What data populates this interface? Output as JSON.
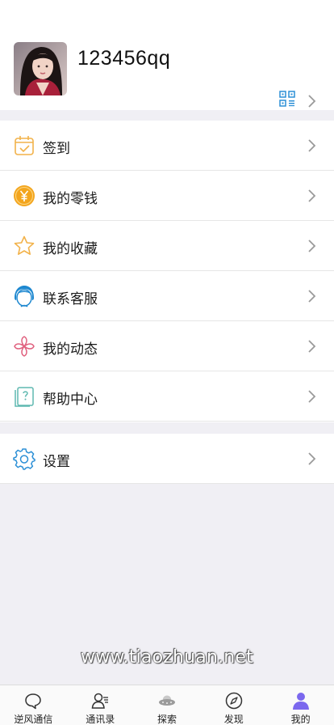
{
  "profile": {
    "username": "123456qq"
  },
  "menu": [
    {
      "label": "签到",
      "icon": "calendar-check-icon"
    },
    {
      "label": "我的零钱",
      "icon": "yuan-coin-icon"
    },
    {
      "label": "我的收藏",
      "icon": "star-icon"
    },
    {
      "label": "联系客服",
      "icon": "customer-service-icon"
    },
    {
      "label": "我的动态",
      "icon": "pinwheel-icon"
    },
    {
      "label": "帮助中心",
      "icon": "help-book-icon"
    }
  ],
  "settings": {
    "label": "设置",
    "icon": "gear-icon"
  },
  "watermark": "www.tiaozhuan.net",
  "tabs": [
    {
      "label": "逆风通信",
      "icon": "chat-bubble-icon"
    },
    {
      "label": "通讯录",
      "icon": "contacts-icon"
    },
    {
      "label": "探索",
      "icon": "ufo-icon"
    },
    {
      "label": "发现",
      "icon": "compass-icon"
    },
    {
      "label": "我的",
      "icon": "person-icon",
      "active": true
    }
  ],
  "colors": {
    "page_bg": "#f0eff4",
    "accent_blue": "#2b8fd6",
    "coin_orange": "#f3a51d",
    "active_tab": "#7b68ee"
  }
}
